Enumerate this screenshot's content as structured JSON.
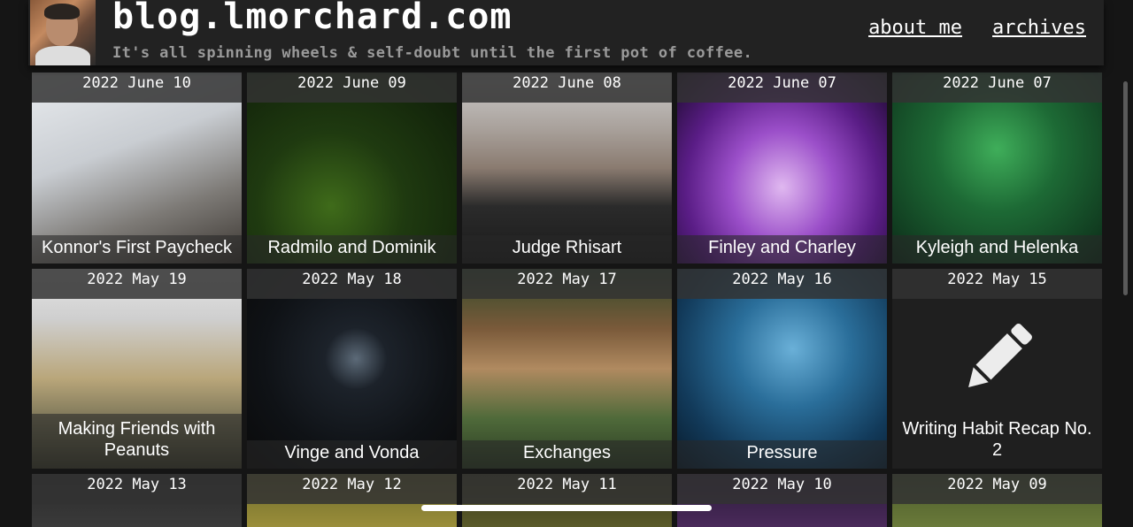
{
  "header": {
    "site_title": "blog.lmorchard.com",
    "tagline": "It's all spinning wheels & self-doubt until the first pot of coffee.",
    "nav": [
      "about me",
      "archives"
    ]
  },
  "posts": [
    {
      "date": "2022 June 10",
      "title": "Konnor's First Paycheck"
    },
    {
      "date": "2022 June 09",
      "title": "Radmilo and Dominik"
    },
    {
      "date": "2022 June 08",
      "title": "Judge Rhisart"
    },
    {
      "date": "2022 June 07",
      "title": "Finley and Charley"
    },
    {
      "date": "2022 June 07",
      "title": "Kyleigh and Helenka"
    },
    {
      "date": "2022 May 19",
      "title": "Making Friends with Peanuts"
    },
    {
      "date": "2022 May 18",
      "title": "Vinge and Vonda"
    },
    {
      "date": "2022 May 17",
      "title": "Exchanges"
    },
    {
      "date": "2022 May 16",
      "title": "Pressure"
    },
    {
      "date": "2022 May 15",
      "title": "Writing Habit Recap No. 2"
    },
    {
      "date": "2022 May 13",
      "title": ""
    },
    {
      "date": "2022 May 12",
      "title": ""
    },
    {
      "date": "2022 May 11",
      "title": ""
    },
    {
      "date": "2022 May 10",
      "title": ""
    },
    {
      "date": "2022 May 09",
      "title": ""
    }
  ],
  "icons": {
    "avatar": "author-photo",
    "writing_habit": "pencil-icon"
  }
}
